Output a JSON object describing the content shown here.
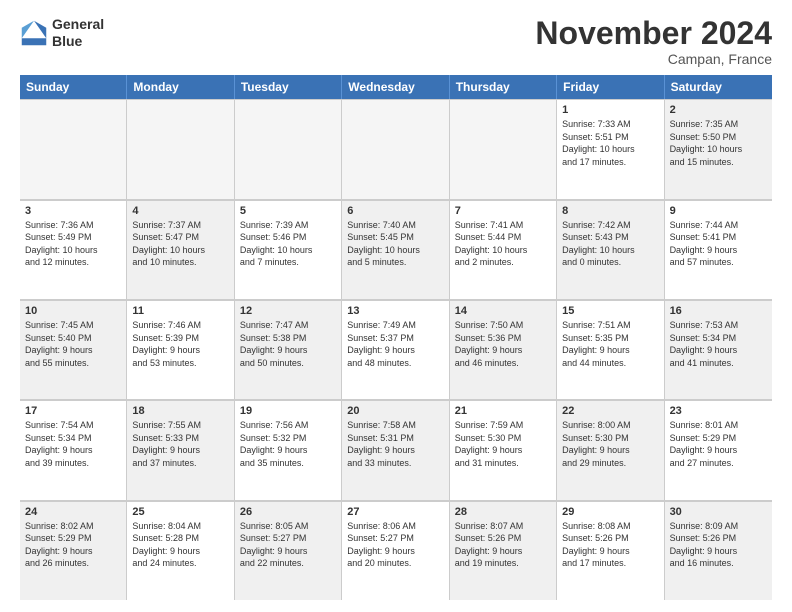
{
  "header": {
    "logo_line1": "General",
    "logo_line2": "Blue",
    "title": "November 2024",
    "subtitle": "Campan, France"
  },
  "weekdays": [
    "Sunday",
    "Monday",
    "Tuesday",
    "Wednesday",
    "Thursday",
    "Friday",
    "Saturday"
  ],
  "weeks": [
    [
      {
        "day": "",
        "info": "",
        "empty": true
      },
      {
        "day": "",
        "info": "",
        "empty": true
      },
      {
        "day": "",
        "info": "",
        "empty": true
      },
      {
        "day": "",
        "info": "",
        "empty": true
      },
      {
        "day": "",
        "info": "",
        "empty": true
      },
      {
        "day": "1",
        "info": "Sunrise: 7:33 AM\nSunset: 5:51 PM\nDaylight: 10 hours\nand 17 minutes.",
        "empty": false
      },
      {
        "day": "2",
        "info": "Sunrise: 7:35 AM\nSunset: 5:50 PM\nDaylight: 10 hours\nand 15 minutes.",
        "empty": false,
        "shaded": true
      }
    ],
    [
      {
        "day": "3",
        "info": "Sunrise: 7:36 AM\nSunset: 5:49 PM\nDaylight: 10 hours\nand 12 minutes.",
        "empty": false
      },
      {
        "day": "4",
        "info": "Sunrise: 7:37 AM\nSunset: 5:47 PM\nDaylight: 10 hours\nand 10 minutes.",
        "empty": false,
        "shaded": true
      },
      {
        "day": "5",
        "info": "Sunrise: 7:39 AM\nSunset: 5:46 PM\nDaylight: 10 hours\nand 7 minutes.",
        "empty": false
      },
      {
        "day": "6",
        "info": "Sunrise: 7:40 AM\nSunset: 5:45 PM\nDaylight: 10 hours\nand 5 minutes.",
        "empty": false,
        "shaded": true
      },
      {
        "day": "7",
        "info": "Sunrise: 7:41 AM\nSunset: 5:44 PM\nDaylight: 10 hours\nand 2 minutes.",
        "empty": false
      },
      {
        "day": "8",
        "info": "Sunrise: 7:42 AM\nSunset: 5:43 PM\nDaylight: 10 hours\nand 0 minutes.",
        "empty": false,
        "shaded": true
      },
      {
        "day": "9",
        "info": "Sunrise: 7:44 AM\nSunset: 5:41 PM\nDaylight: 9 hours\nand 57 minutes.",
        "empty": false
      }
    ],
    [
      {
        "day": "10",
        "info": "Sunrise: 7:45 AM\nSunset: 5:40 PM\nDaylight: 9 hours\nand 55 minutes.",
        "empty": false,
        "shaded": true
      },
      {
        "day": "11",
        "info": "Sunrise: 7:46 AM\nSunset: 5:39 PM\nDaylight: 9 hours\nand 53 minutes.",
        "empty": false
      },
      {
        "day": "12",
        "info": "Sunrise: 7:47 AM\nSunset: 5:38 PM\nDaylight: 9 hours\nand 50 minutes.",
        "empty": false,
        "shaded": true
      },
      {
        "day": "13",
        "info": "Sunrise: 7:49 AM\nSunset: 5:37 PM\nDaylight: 9 hours\nand 48 minutes.",
        "empty": false
      },
      {
        "day": "14",
        "info": "Sunrise: 7:50 AM\nSunset: 5:36 PM\nDaylight: 9 hours\nand 46 minutes.",
        "empty": false,
        "shaded": true
      },
      {
        "day": "15",
        "info": "Sunrise: 7:51 AM\nSunset: 5:35 PM\nDaylight: 9 hours\nand 44 minutes.",
        "empty": false
      },
      {
        "day": "16",
        "info": "Sunrise: 7:53 AM\nSunset: 5:34 PM\nDaylight: 9 hours\nand 41 minutes.",
        "empty": false,
        "shaded": true
      }
    ],
    [
      {
        "day": "17",
        "info": "Sunrise: 7:54 AM\nSunset: 5:34 PM\nDaylight: 9 hours\nand 39 minutes.",
        "empty": false
      },
      {
        "day": "18",
        "info": "Sunrise: 7:55 AM\nSunset: 5:33 PM\nDaylight: 9 hours\nand 37 minutes.",
        "empty": false,
        "shaded": true
      },
      {
        "day": "19",
        "info": "Sunrise: 7:56 AM\nSunset: 5:32 PM\nDaylight: 9 hours\nand 35 minutes.",
        "empty": false
      },
      {
        "day": "20",
        "info": "Sunrise: 7:58 AM\nSunset: 5:31 PM\nDaylight: 9 hours\nand 33 minutes.",
        "empty": false,
        "shaded": true
      },
      {
        "day": "21",
        "info": "Sunrise: 7:59 AM\nSunset: 5:30 PM\nDaylight: 9 hours\nand 31 minutes.",
        "empty": false
      },
      {
        "day": "22",
        "info": "Sunrise: 8:00 AM\nSunset: 5:30 PM\nDaylight: 9 hours\nand 29 minutes.",
        "empty": false,
        "shaded": true
      },
      {
        "day": "23",
        "info": "Sunrise: 8:01 AM\nSunset: 5:29 PM\nDaylight: 9 hours\nand 27 minutes.",
        "empty": false
      }
    ],
    [
      {
        "day": "24",
        "info": "Sunrise: 8:02 AM\nSunset: 5:29 PM\nDaylight: 9 hours\nand 26 minutes.",
        "empty": false,
        "shaded": true
      },
      {
        "day": "25",
        "info": "Sunrise: 8:04 AM\nSunset: 5:28 PM\nDaylight: 9 hours\nand 24 minutes.",
        "empty": false
      },
      {
        "day": "26",
        "info": "Sunrise: 8:05 AM\nSunset: 5:27 PM\nDaylight: 9 hours\nand 22 minutes.",
        "empty": false,
        "shaded": true
      },
      {
        "day": "27",
        "info": "Sunrise: 8:06 AM\nSunset: 5:27 PM\nDaylight: 9 hours\nand 20 minutes.",
        "empty": false
      },
      {
        "day": "28",
        "info": "Sunrise: 8:07 AM\nSunset: 5:26 PM\nDaylight: 9 hours\nand 19 minutes.",
        "empty": false,
        "shaded": true
      },
      {
        "day": "29",
        "info": "Sunrise: 8:08 AM\nSunset: 5:26 PM\nDaylight: 9 hours\nand 17 minutes.",
        "empty": false
      },
      {
        "day": "30",
        "info": "Sunrise: 8:09 AM\nSunset: 5:26 PM\nDaylight: 9 hours\nand 16 minutes.",
        "empty": false,
        "shaded": true
      }
    ]
  ]
}
